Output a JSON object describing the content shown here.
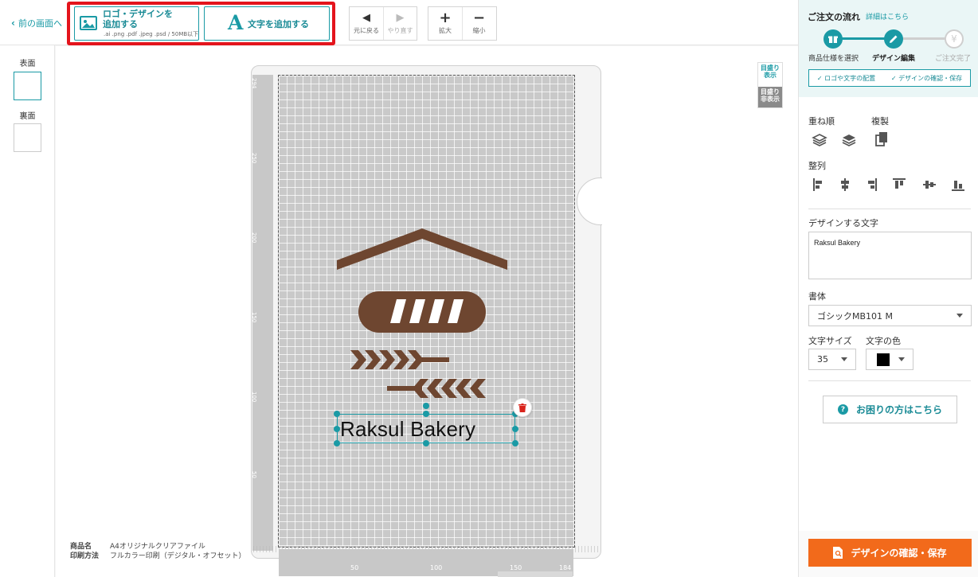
{
  "toolbar": {
    "back_label": "前の画面へ",
    "add_logo_line1": "ロゴ・デザインを",
    "add_logo_line2": "追加する",
    "add_logo_formats": ".ai .png .pdf .jpeg .psd / 50MB以下",
    "add_text_label": "文字を追加する",
    "undo_label": "元に戻る",
    "redo_label": "やり直す",
    "zoom_in_label": "拡大",
    "zoom_out_label": "縮小",
    "accent_color": "#1a9aa5",
    "highlight_color": "#e4141c"
  },
  "sides": {
    "front_label": "表面",
    "back_label": "裏面"
  },
  "guide": {
    "show_label": "目盛り表示",
    "hide_label": "目盛り非表示"
  },
  "ruler": {
    "vertical": [
      "294",
      "250",
      "200",
      "150",
      "100",
      "50"
    ],
    "horizontal": [
      "50",
      "100",
      "150",
      "184"
    ]
  },
  "design": {
    "text_object": "Raksul Bakery",
    "brand_color": "#6e4630"
  },
  "product": {
    "name_key": "商品名",
    "name_value": "A4オリジナルクリアファイル",
    "method_key": "印刷方法",
    "method_value": "フルカラー印刷（デジタル・オフセット）"
  },
  "panel": {
    "flow_title": "ご注文の流れ",
    "flow_link": "詳細はこちら",
    "steps": [
      {
        "label": "商品仕様を選択",
        "state": "done"
      },
      {
        "label": "デザイン編集",
        "state": "current"
      },
      {
        "label": "ご注文完了",
        "state": "pending"
      }
    ],
    "check1": "✓ ロゴや文字の配置",
    "check2": "✓ デザインの確認・保存",
    "order_label": "重ね順",
    "copy_label": "複製",
    "align_label": "整列",
    "text_section_label": "デザインする文字",
    "text_value": "Raksul Bakery",
    "font_label": "書体",
    "font_value": "ゴシックMB101 M",
    "size_label": "文字サイズ",
    "size_value": "35",
    "color_label": "文字の色",
    "color_value": "#000000",
    "help_label": "お困りの方はこちら",
    "confirm_label": "デザインの確認・保存",
    "confirm_color": "#f26a1b"
  }
}
